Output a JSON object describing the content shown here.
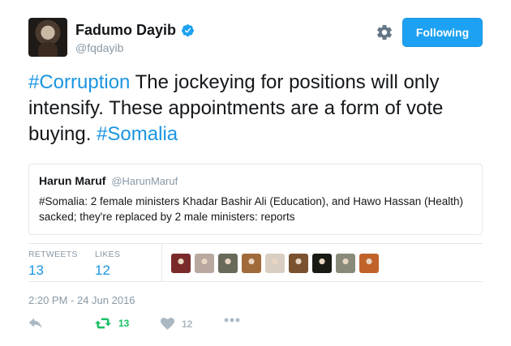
{
  "author": {
    "display_name": "Fadumo Dayib",
    "handle": "@fqdayib",
    "verified": true
  },
  "follow_button": {
    "label": "Following"
  },
  "tweet": {
    "hashtag_1": "#Corruption",
    "text_body": " The jockeying for positions will only intensify. These appointments are a form of vote buying. ",
    "hashtag_2": "#Somalia"
  },
  "quoted_tweet": {
    "name": "Harun Maruf",
    "handle": "@HarunMaruf",
    "text": "#Somalia: 2 female ministers Khadar Bashir Ali (Education), and Hawo Hassan (Health) sacked; they're replaced by 2 male ministers: reports"
  },
  "stats": {
    "retweets_label": "RETWEETS",
    "retweets_count": "13",
    "likes_label": "LIKES",
    "likes_count": "12"
  },
  "likers": [
    {
      "color": "#7a2a2a"
    },
    {
      "color": "#b8a8a0"
    },
    {
      "color": "#6a6a5a"
    },
    {
      "color": "#a06a3a"
    },
    {
      "color": "#d8cfc2"
    },
    {
      "color": "#7a5230"
    },
    {
      "color": "#1a1a14"
    },
    {
      "color": "#8a8a7a"
    },
    {
      "color": "#c0622a"
    }
  ],
  "timestamp": "2:20 PM - 24 Jun 2016",
  "actions": {
    "retweet_count": "13",
    "like_count": "12"
  },
  "colors": {
    "accent": "#1da1f2",
    "link": "#1b95e0",
    "retweet_green": "#17bf63",
    "muted": "#8899a6"
  }
}
